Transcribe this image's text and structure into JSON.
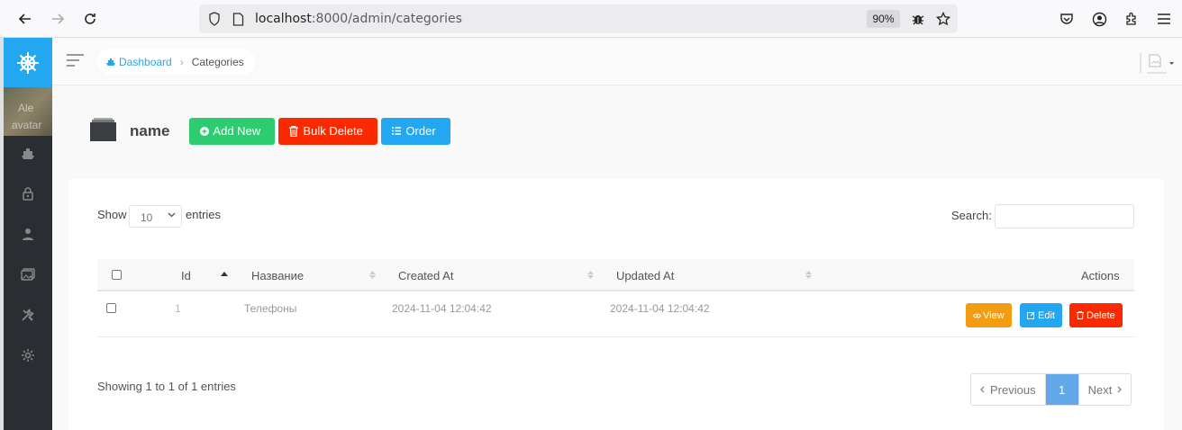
{
  "browser": {
    "url_host": "localhost",
    "url_path": ":8000/admin/categories",
    "zoom": "90%"
  },
  "sidebar": {
    "avatar_alt_line1": "Ale",
    "avatar_alt_line2": "avatar",
    "items": [
      {
        "icon": "dashboard-boat-icon"
      },
      {
        "icon": "lock-icon"
      },
      {
        "icon": "user-icon"
      },
      {
        "icon": "media-icon"
      },
      {
        "icon": "tools-icon"
      },
      {
        "icon": "settings-gear-icon"
      }
    ]
  },
  "breadcrumb": {
    "dashboard": "Dashboard",
    "current": "Categories"
  },
  "page": {
    "title": "name",
    "add_new": "Add New",
    "bulk_delete": "Bulk Delete",
    "order": "Order"
  },
  "table_controls": {
    "show": "Show",
    "entries_value": "10",
    "entries": "entries",
    "search": "Search:"
  },
  "table": {
    "columns": [
      "Id",
      "Название",
      "Created At",
      "Updated At",
      "Actions"
    ],
    "rows": [
      {
        "id": "1",
        "name": "Телефоны",
        "created_at": "2024-11-04 12:04:42",
        "updated_at": "2024-11-04 12:04:42",
        "view": "View",
        "edit": "Edit",
        "delete": "Delete"
      }
    ]
  },
  "footer": {
    "showing": "Showing 1 to 1 of 1 entries",
    "previous": "Previous",
    "page": "1",
    "next": "Next"
  },
  "colors": {
    "brand": "#22a7f0",
    "success": "#2ecc71",
    "danger": "#fa2a00",
    "warning": "#f39c12",
    "sidebar": "#2a2d31"
  }
}
